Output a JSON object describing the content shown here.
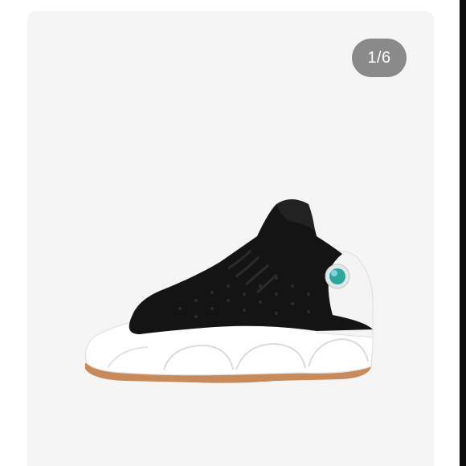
{
  "gallery": {
    "counter_text": "1/6",
    "background_color": "#f5f5f5",
    "counter_color": "#8a8a8a"
  },
  "product_image": {
    "icon": "sneaker-image",
    "colors": {
      "upper": "#141414",
      "midsole": "#ffffff",
      "outsole": "#c98a5a",
      "hologram": "#2aa89a"
    }
  }
}
